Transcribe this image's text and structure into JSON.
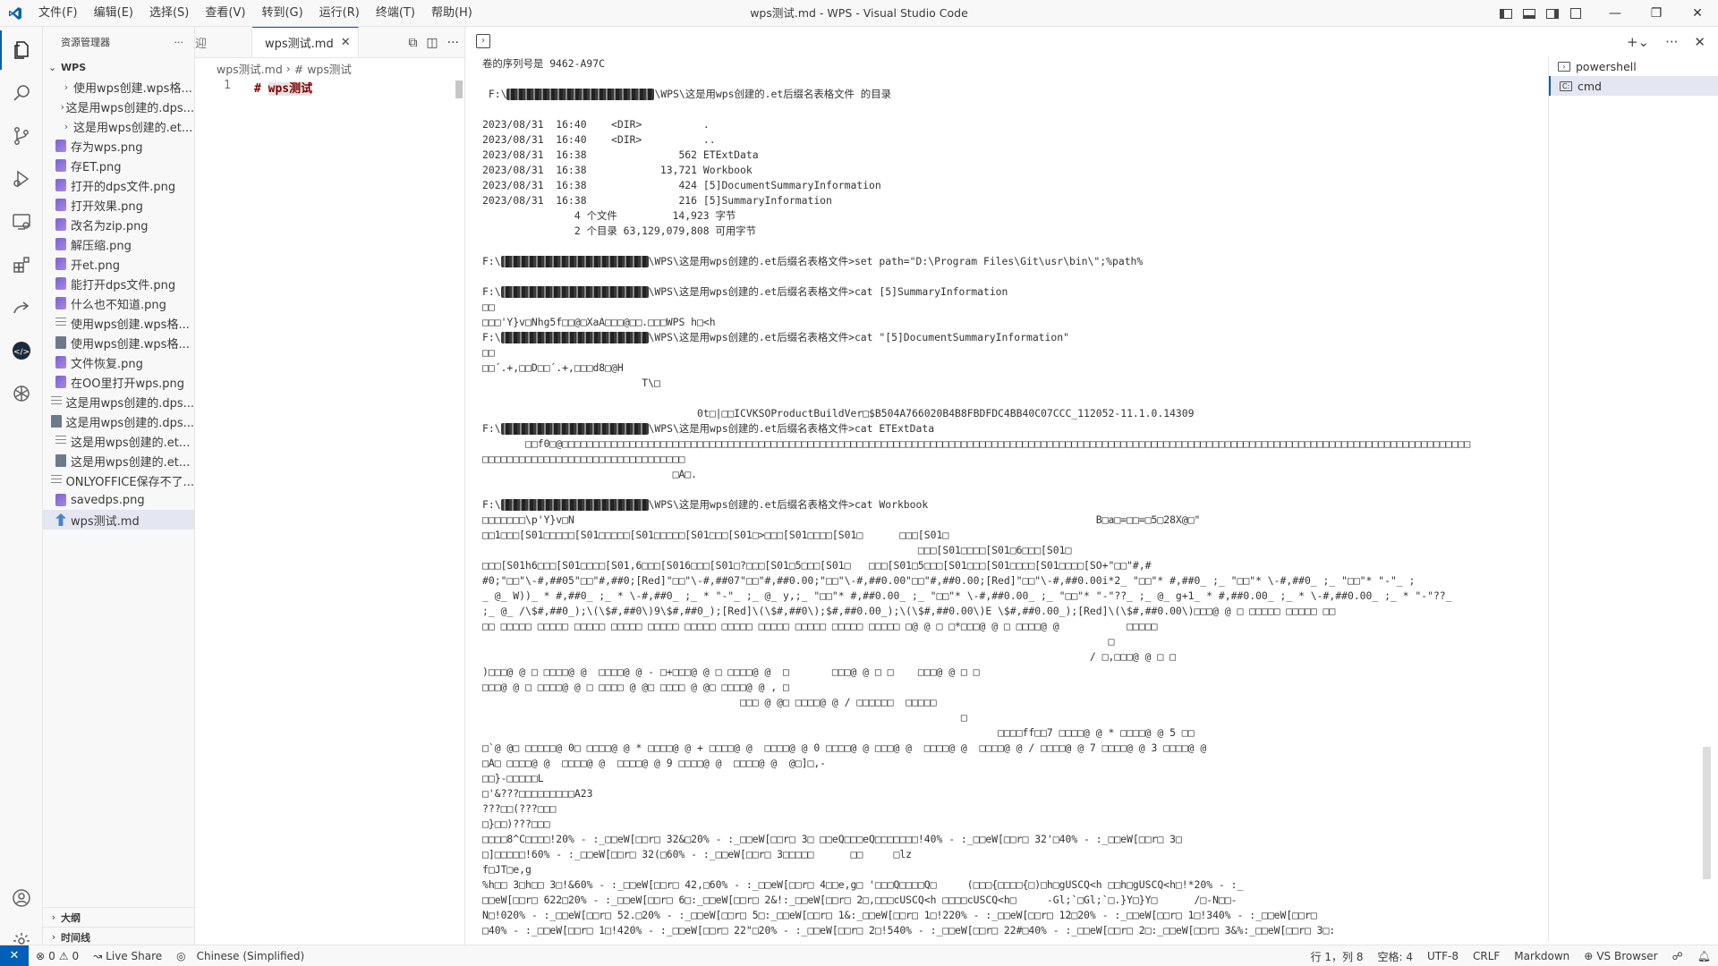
{
  "window": {
    "title": "wps测试.md - WPS - Visual Studio Code",
    "menu": [
      "文件(F)",
      "编辑(E)",
      "选择(S)",
      "查看(V)",
      "转到(G)",
      "运行(R)",
      "终端(T)",
      "帮助(H)"
    ]
  },
  "activity": [
    "files-icon",
    "search-icon",
    "source-control-icon",
    "run-debug-icon",
    "remote-explorer-icon",
    "extensions-icon",
    "live-share-icon",
    "chat-icon",
    "openai-icon"
  ],
  "sidebar": {
    "title": "资源管理器",
    "more": "···",
    "root": "WPS",
    "items": [
      {
        "label": "使用wps创建.wps格...",
        "type": "folder"
      },
      {
        "label": "这是用wps创建的.dps...",
        "type": "folder"
      },
      {
        "label": "这是用wps创建的.et...",
        "type": "folder"
      },
      {
        "label": "存为wps.png",
        "type": "img"
      },
      {
        "label": "存ET.png",
        "type": "img"
      },
      {
        "label": "打开的dps文件.png",
        "type": "img"
      },
      {
        "label": "打开效果.png",
        "type": "img"
      },
      {
        "label": "改名为zip.png",
        "type": "img"
      },
      {
        "label": "解压缩.png",
        "type": "img"
      },
      {
        "label": "开et.png",
        "type": "img"
      },
      {
        "label": "能打开dps文件.png",
        "type": "img"
      },
      {
        "label": "什么也不知道.png",
        "type": "img"
      },
      {
        "label": "使用wps创建.wps格...",
        "type": "txt"
      },
      {
        "label": "使用wps创建.wps格...",
        "type": "file"
      },
      {
        "label": "文件恢复.png",
        "type": "img"
      },
      {
        "label": "在OO里打开wps.png",
        "type": "img"
      },
      {
        "label": "这是用wps创建的.dps...",
        "type": "txt"
      },
      {
        "label": "这是用wps创建的.dps...",
        "type": "file"
      },
      {
        "label": "这是用wps创建的.et...",
        "type": "txt"
      },
      {
        "label": "这是用wps创建的.et...",
        "type": "file"
      },
      {
        "label": "ONLYOFFICE保存不了...",
        "type": "txt"
      },
      {
        "label": "savedps.png",
        "type": "img"
      },
      {
        "label": "wps测试.md",
        "type": "md",
        "selected": true
      }
    ],
    "outline": "大纲",
    "timeline": "时间线"
  },
  "editor": {
    "prev_tab": "迎",
    "tab_label": "wps测试.md",
    "breadcrumb_file": "wps测试.md",
    "breadcrumb_symbol": "# wps测试",
    "line_number": "1",
    "code_prefix": "# ",
    "code_text": "wps测试"
  },
  "terminal": {
    "tabs": [
      "powershell",
      "cmd"
    ],
    "lines": [
      "卷的序列号是 9462-A97C",
      "",
      " F:\\[R]\\WPS\\这是用wps创建的.et后缀名表格文件 的目录",
      "",
      "2023/08/31  16:40    <DIR>          .",
      "2023/08/31  16:40    <DIR>          ..",
      "2023/08/31  16:38               562 ETExtData",
      "2023/08/31  16:38            13,721 Workbook",
      "2023/08/31  16:38               424 [5]DocumentSummaryInformation",
      "2023/08/31  16:38               216 [5]SummaryInformation",
      "               4 个文件         14,923 字节",
      "               2 个目录 63,129,079,808 可用字节",
      "",
      "F:\\[R]\\WPS\\这是用wps创建的.et后缀名表格文件>set path=\"D:\\Program Files\\Git\\usr\\bin\\\";%path%",
      "",
      "F:\\[R]\\WPS\\这是用wps创建的.et后缀名表格文件>cat [5]SummaryInformation",
      "□□",
      "□□□'Y}v□Nhg5f□□@□XaA□□□@□□.□□□WPS h□<h",
      "F:\\[R]\\WPS\\这是用wps创建的.et后缀名表格文件>cat \"[5]DocumentSummaryInformation\"",
      "□□",
      "□□´.+,□□D□□´.+,□□□d8□@H",
      "                          T\\□",
      "",
      "                                   0t□|□□ICVKSOProductBuildVer□$B504A766020B4B8FBDFDC4BB40C07CCC_112052-11.1.0.14309",
      "F:\\[R]\\WPS\\这是用wps创建的.et后缀名表格文件>cat ETExtData",
      "       □□f0□@□□□□□□□□□□□□□□□□□□□□□□□□□□□□□□□□□□□□□□□□□□□□□□□□□□□□□□□□□□□□□□□□□□□□□□□□□□□□□□□□□□□□□□□□□□□□□□□□□□□□□□□□□□□□□□□□□□□□□□□□□□□□□□□□□□□□□□□□□□□□□□□□□□□□",
      "□□□□□□□□□□□□□□□□□□□□□□□□□□□□□□□□□",
      "                               □A□.",
      "",
      "F:\\[R]\\WPS\\这是用wps创建的.et后缀名表格文件>cat Workbook",
      "□□□□□□□\\p'Y}v□N                                                                                     B□a□=□□=□5□28X@□\"",
      "□□1□□□[S01□□□□□[S01□□□□□[S01□□□□□[S01□□□[S01□>□□□[S01□□□□[S01□      □□□[S01□",
      "                                                                       □□□[S01□□□□[S01□6□□□[S01□",
      "□□□[S01h6□□□[S01□□□□[S01,6□□□[S016□□□[S01□?□□□[S01□5□□□[S01□   □□□[S01□5□□□[S01□□□[S01□□□□[S01□□□□[SO+\"□□\"#,#",
      "#0;\"□□\"\\-#,##05\"□□\"#,##0;[Red]\"□□\"\\-#,##07\"□□\"#,##0.00;\"□□\"\\-#,##0.00\"□□\"#,##0.00;[Red]\"□□\"\\-#,##0.00i*2_ \"□□\"* #,##0_ ;_ \"□□\"* \\-#,##0_ ;_ \"□□\"* \"-\"_ ;",
      "_ @_ W))_ * #,##0_ ;_ * \\-#,##0_ ;_ * \"-\"_ ;_ @_ y,;_ \"□□\"* #,##0.00_ ;_ \"□□\"* \\-#,##0.00_ ;_ \"□□\"* \"-\"??_ ;_ @_ g+1_ * #,##0.00_ ;_ * \\-#,##0.00_ ;_ * \"-\"??_",
      ";_ @_ /\\$#,##0_);\\(\\$#,##0\\)9\\$#,##0_);[Red]\\(\\$#,##0\\);$#,##0.00_);\\(\\$#,##0.00\\)E \\$#,##0.00_);[Red]\\(\\$#,##0.00\\)□□□@ @ □ □□□□□ □□□□□ □□",
      "□□ □□□□□ □□□□□ □□□□□ □□□□□ □□□□□ □□□□□ □□□□□ □□□□□ □□□□□ □□□□□ □□□□□ □@ @ □ □*□□□@ @ □ □□□□@ @           □□□□□",
      "                                                                                                      □",
      "                                                                                                   / □,□□□@ @ □ □",
      ")□□□@ @ □ □□□□@ @  □□□□@ @ - □+□□□@ @ □ □□□□@ @  □       □□□@ @ □ □    □□□@ @ □ □",
      "□□□@ @ □ □□□□@ @ □ □□□□ @ @□ □□□□ @ @□ □□□□@ @ , □",
      "                                          □□□ @ @□ □□□□@ @ / □□□□□□  □□□□□",
      "                                                                              □",
      "                                                                                    □□□□ff□□7 □□□□@ @ * □□□□@ @ 5 □□",
      "□`@ @□ □□□□□@ 0□ □□□□@ @ * □□□□@ @ + □□□□@ @  □□□□@ @ 0 □□□□@ @ □□□@ @  □□□□@ @  □□□□@ @ / □□□□@ @ 7 □□□□@ @ 3 □□□□@ @",
      "□A□ □□□□@ @  □□□□@ @  □□□□@ @ 9 □□□□@ @  □□□□@ @  @□]□,-",
      "□□}-□□□□□L",
      "□'&???□□□□□□□□□A23",
      "???□□(???□□□",
      "□}□□)???□□□",
      "□□□□8^C□□□□!20% - :_□□eW[□□r□ 32&□20% - :_□□eW[□□r□ 3□ □□eQ□□□eQ□□□□□□□!40% - :_□□eW[□□r□ 32'□40% - :_□□eW[□□r□ 3□",
      "□]□□□□□!60% - :_□□eW[□□r□ 32(□60% - :_□□eW[□□r□ 3□□□□□      □□     □lz",
      "f□JT□e,g",
      "%h□□ 3□h□□ 3□!&60% - :_□□eW[□□r□ 42,□60% - :_□□eW[□□r□ 4□□e,g□ '□□□Q□□□□Q□     (□□□{□□□□{□)□h□gUSCQ<h □□h□gUSCQ<h□!*20% - :_",
      "□□eW[□□r□ 622□20% - :_□□eW[□□r□ 6□:_□□eW[□□r□ 2&!:_□□eW[□□r□ 2□,□□□cUSCQ<h □□□□cUSCQ<h□     -Gl;`□Gl;`□.}Y□}Y□      /□-N□□-",
      "N□!020% - :_□□eW[□□r□ 52.□20% - :_□□eW[□□r□ 5□:_□□eW[□□r□ 1&:_□□eW[□□r□ 1□!220% - :_□□eW[□□r□ 12□20% - :_□□eW[□□r□ 1□!340% - :_□□eW[□□r□",
      "□40% - :_□□eW[□□r□ 1□!420% - :_□□eW[□□r□ 22\"□20% - :_□□eW[□□r□ 2□!540% - :_□□eW[□□r□ 22#□40% - :_□□eW[□□r□ 2□:_□□eW[□□r□ 3&%:_□□eW[□□r□ 3□:"
    ]
  },
  "statusbar": {
    "errors": "0",
    "warnings": "0",
    "live_share": "Live Share",
    "language_pack": "Chinese (Simplified)",
    "position": "行 1，列 8",
    "spaces": "空格: 4",
    "encoding": "UTF-8",
    "eol": "CRLF",
    "language": "Markdown",
    "browser": "VS Browser"
  },
  "colors": {
    "accent": "#005fb8",
    "heading": "#800000"
  }
}
